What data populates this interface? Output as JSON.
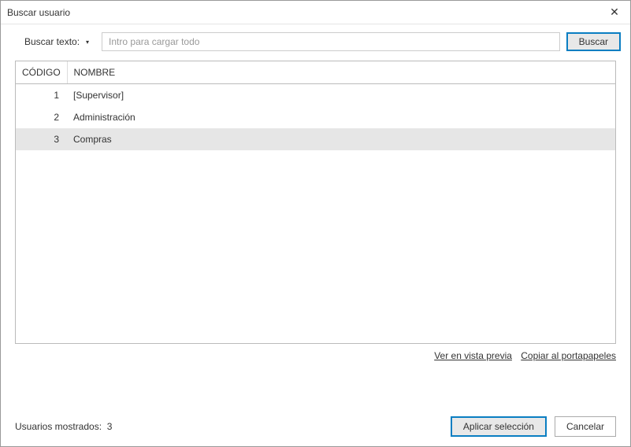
{
  "titlebar": {
    "title": "Buscar usuario"
  },
  "search": {
    "label": "Buscar texto:",
    "placeholder": "Intro para cargar todo",
    "button": "Buscar"
  },
  "table": {
    "headers": {
      "code": "CÓDIGO",
      "name": "NOMBRE"
    },
    "rows": [
      {
        "code": "1",
        "name": "[Supervisor]",
        "selected": false
      },
      {
        "code": "2",
        "name": "Administración",
        "selected": false
      },
      {
        "code": "3",
        "name": "Compras",
        "selected": true
      }
    ]
  },
  "links": {
    "preview": "Ver en vista previa",
    "copy": "Copiar al portapapeles"
  },
  "footer": {
    "status_label": "Usuarios mostrados:",
    "status_count": "3",
    "apply": "Aplicar selección",
    "cancel": "Cancelar"
  }
}
